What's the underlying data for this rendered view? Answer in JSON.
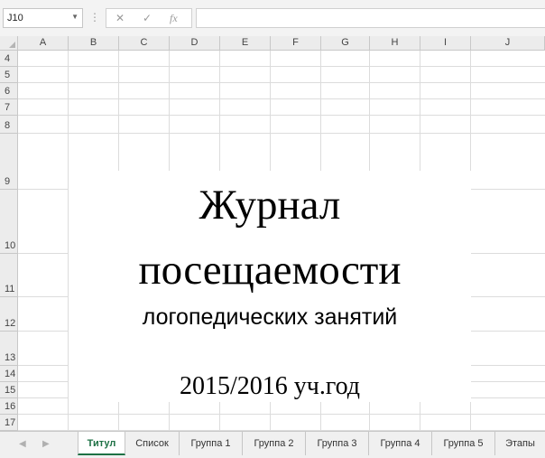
{
  "formula_bar": {
    "name_box": "J10",
    "cancel_icon": "✕",
    "enter_icon": "✓",
    "function_icon": "fx",
    "formula": ""
  },
  "columns": [
    "A",
    "B",
    "C",
    "D",
    "E",
    "F",
    "G",
    "H",
    "I",
    "J"
  ],
  "rows": [
    "4",
    "5",
    "6",
    "7",
    "8",
    "9",
    "10",
    "11",
    "12",
    "13",
    "14",
    "15",
    "16",
    "17"
  ],
  "content": {
    "line1": "Журнал",
    "line2": "посещаемости",
    "line3": "логопедических занятий",
    "line4": "2015/2016 уч.год"
  },
  "sheet_tabs": {
    "active_index": 0,
    "tabs": [
      "Титул",
      "Список",
      "Группа 1",
      "Группа 2",
      "Группа 3",
      "Группа 4",
      "Группа 5",
      "Этапы"
    ]
  },
  "colors": {
    "accent": "#1e7145",
    "header_bg": "#ececec",
    "gridline": "#dcdcdc"
  }
}
